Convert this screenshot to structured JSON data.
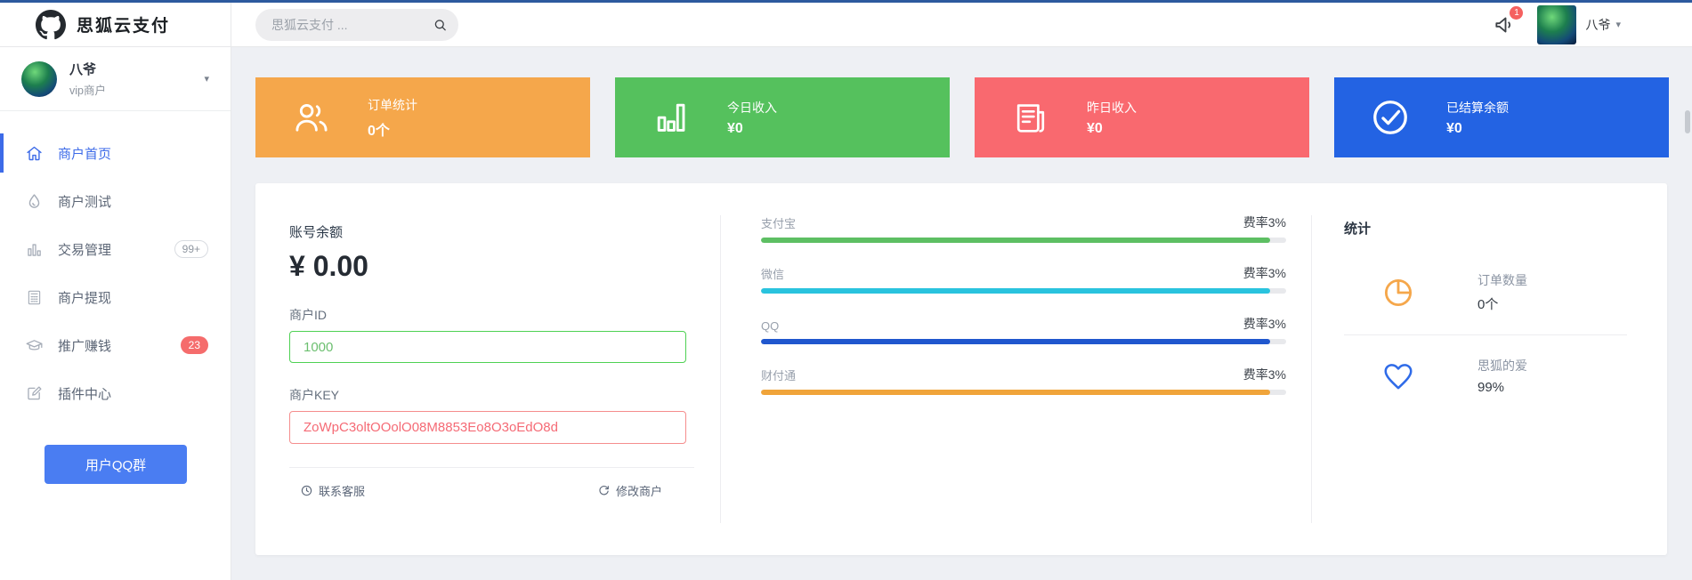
{
  "brand": {
    "title": "思狐云支付",
    "logo_icon": "github-logo"
  },
  "header": {
    "search_placeholder": "思狐云支付 ...",
    "notification_count": "1",
    "username": "八爷",
    "caret": "▾"
  },
  "sidebar": {
    "user": {
      "name": "八爷",
      "role": "vip商户",
      "caret": "▾"
    },
    "items": [
      {
        "key": "merchant-home",
        "label": "商户首页",
        "icon": "home-icon",
        "active": true
      },
      {
        "key": "merchant-test",
        "label": "商户测试",
        "icon": "drop-icon"
      },
      {
        "key": "trade-manage",
        "label": "交易管理",
        "icon": "chart-icon",
        "badge": "99+",
        "badge_type": "outline"
      },
      {
        "key": "merchant-withdraw",
        "label": "商户提现",
        "icon": "calc-icon"
      },
      {
        "key": "promote-earn",
        "label": "推广赚钱",
        "icon": "cap-icon",
        "badge": "23",
        "badge_type": "solid"
      },
      {
        "key": "plugin-center",
        "label": "插件中心",
        "icon": "edit-icon"
      }
    ],
    "qq_button_label": "用户QQ群"
  },
  "stat_cards": [
    {
      "key": "orders",
      "title": "订单统计",
      "value": "0个",
      "color": "#f5a74b",
      "icon": "users-icon"
    },
    {
      "key": "today-income",
      "title": "今日收入",
      "value": "¥0",
      "color": "#55c15d",
      "icon": "bars-icon"
    },
    {
      "key": "yesterday-income",
      "title": "昨日收入",
      "value": "¥0",
      "color": "#f9696f",
      "icon": "news-icon"
    },
    {
      "key": "settled-balance",
      "title": "已结算余额",
      "value": "¥0",
      "color": "#2363e3",
      "icon": "check-circle-icon"
    }
  ],
  "account": {
    "balance_label": "账号余额",
    "balance_value": "¥ 0.00",
    "merchant_id_label": "商户ID",
    "merchant_id_value": "1000",
    "merchant_key_label": "商户KEY",
    "merchant_key_value": "ZoWpC3oltOOolO08M8853Eo8O3oEdO8d",
    "contact_link": "联系客服",
    "modify_link": "修改商户"
  },
  "rates": {
    "items": [
      {
        "channel": "支付宝",
        "rate_label": "费率3%",
        "percent": 97,
        "color": "#5dbf63"
      },
      {
        "channel": "微信",
        "rate_label": "费率3%",
        "percent": 97,
        "color": "#29c3de"
      },
      {
        "channel": "QQ",
        "rate_label": "费率3%",
        "percent": 97,
        "color": "#2057ce"
      },
      {
        "channel": "财付通",
        "rate_label": "费率3%",
        "percent": 97,
        "color": "#f0a43a"
      }
    ]
  },
  "stats_panel": {
    "title": "统计",
    "items": [
      {
        "label": "订单数量",
        "value": "0个",
        "icon": "pie-chart-icon",
        "icon_color": "#f5a74b"
      },
      {
        "label": "思狐的爱",
        "value": "99%",
        "icon": "heart-icon",
        "icon_color": "#2f6be8"
      }
    ]
  },
  "colors": {
    "accent_blue": "#3d6be8",
    "badge_red": "#f56c6c",
    "qq_button": "#4a7df2",
    "input_ok_border": "#4ed153",
    "input_err_border": "#f58d8d",
    "main_background": "#eef0f4"
  }
}
